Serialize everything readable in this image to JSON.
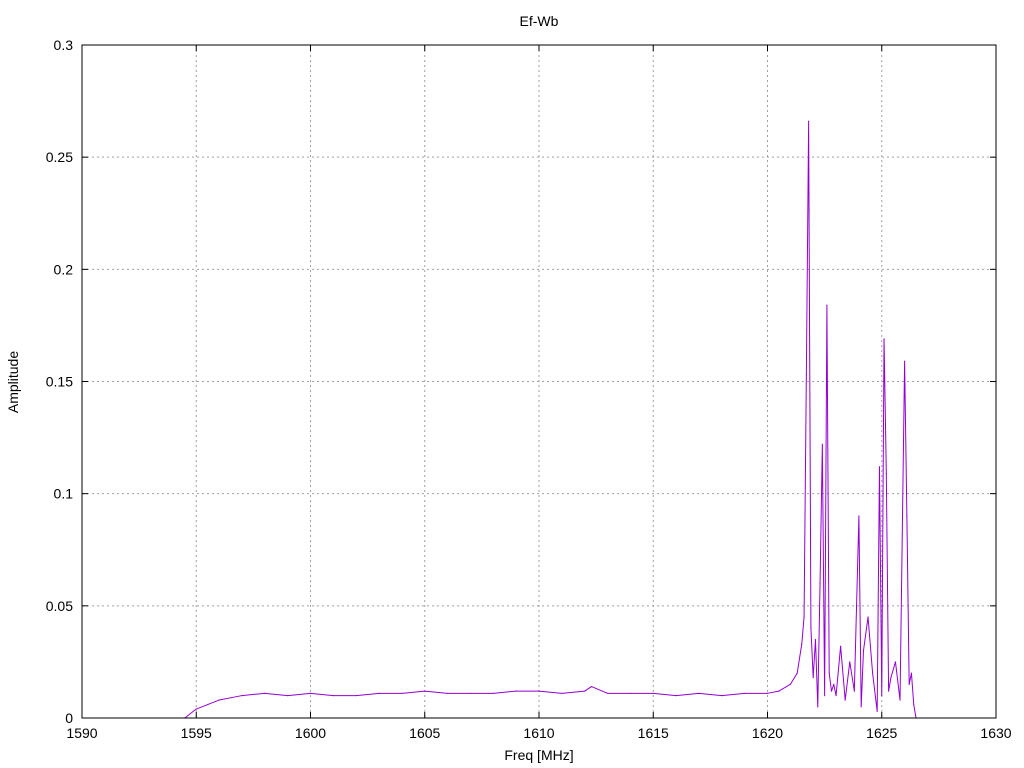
{
  "chart_data": {
    "type": "line",
    "title": "Ef-Wb",
    "xlabel": "Freq [MHz]",
    "ylabel": "Amplitude",
    "xlim": [
      1590,
      1630
    ],
    "ylim": [
      0,
      0.3
    ],
    "x_ticks": [
      1590,
      1595,
      1600,
      1605,
      1610,
      1615,
      1620,
      1625,
      1630
    ],
    "y_ticks": [
      0,
      0.05,
      0.1,
      0.15,
      0.2,
      0.25,
      0.3
    ],
    "x_tick_labels": [
      "1590",
      "1595",
      "1600",
      "1605",
      "1610",
      "1615",
      "1620",
      "1625",
      "1630"
    ],
    "y_tick_labels": [
      "0",
      "0.05",
      "0.1",
      "0.15",
      "0.2",
      "0.25",
      "0.3"
    ],
    "grid": true,
    "line_color": "#9400d3",
    "series": [
      {
        "x": [
          1594.5,
          1595.0,
          1595.5,
          1596.0,
          1596.5,
          1597.0,
          1598.0,
          1599.0,
          1600.0,
          1601.0,
          1602.0,
          1603.0,
          1604.0,
          1605.0,
          1606.0,
          1607.0,
          1608.0,
          1609.0,
          1610.0,
          1611.0,
          1612.0,
          1612.3,
          1613.0,
          1614.0,
          1615.0,
          1616.0,
          1617.0,
          1618.0,
          1619.0,
          1620.0,
          1620.5,
          1621.0,
          1621.3,
          1621.5,
          1621.6,
          1621.7,
          1621.8,
          1621.9,
          1622.0,
          1622.1,
          1622.2,
          1622.3,
          1622.4,
          1622.5,
          1622.6,
          1622.7,
          1622.8,
          1622.9,
          1623.0,
          1623.2,
          1623.4,
          1623.6,
          1623.8,
          1624.0,
          1624.1,
          1624.2,
          1624.4,
          1624.6,
          1624.8,
          1624.9,
          1625.0,
          1625.1,
          1625.2,
          1625.3,
          1625.4,
          1625.6,
          1625.8,
          1626.0,
          1626.1,
          1626.2,
          1626.3,
          1626.4,
          1626.5
        ],
        "y": [
          0.0,
          0.004,
          0.006,
          0.008,
          0.009,
          0.01,
          0.011,
          0.01,
          0.011,
          0.01,
          0.01,
          0.011,
          0.011,
          0.012,
          0.011,
          0.011,
          0.011,
          0.012,
          0.012,
          0.011,
          0.012,
          0.014,
          0.011,
          0.011,
          0.011,
          0.01,
          0.011,
          0.01,
          0.011,
          0.011,
          0.012,
          0.015,
          0.02,
          0.033,
          0.045,
          0.153,
          0.266,
          0.04,
          0.018,
          0.035,
          0.005,
          0.06,
          0.122,
          0.01,
          0.184,
          0.02,
          0.012,
          0.015,
          0.01,
          0.032,
          0.008,
          0.025,
          0.012,
          0.09,
          0.005,
          0.03,
          0.045,
          0.02,
          0.003,
          0.112,
          0.01,
          0.169,
          0.109,
          0.012,
          0.018,
          0.025,
          0.008,
          0.159,
          0.09,
          0.015,
          0.02,
          0.006,
          0.0
        ]
      }
    ]
  }
}
